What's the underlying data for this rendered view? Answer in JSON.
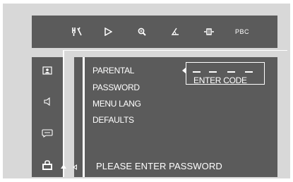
{
  "toolbar": {
    "icons": [
      "tuning-fork-wrench-icon",
      "play-icon",
      "zoom-icon",
      "angle-icon",
      "chapter-icon"
    ],
    "pbc_label": "PBC"
  },
  "sidebar": {
    "icons": [
      "person-icon",
      "speaker-icon",
      "subtitle-icon",
      "lock-icon"
    ]
  },
  "menu": {
    "items": [
      "PARENTAL",
      "PASSWORD",
      "MENU LANG",
      "DEFAULTS"
    ]
  },
  "code_entry": {
    "label": "ENTER CODE",
    "slots": 4
  },
  "status_text": "PLEASE ENTER PASSWORD",
  "colors": {
    "panel": "#5b5b5b",
    "background": "#d8d8d8",
    "text": "#ffffff"
  }
}
